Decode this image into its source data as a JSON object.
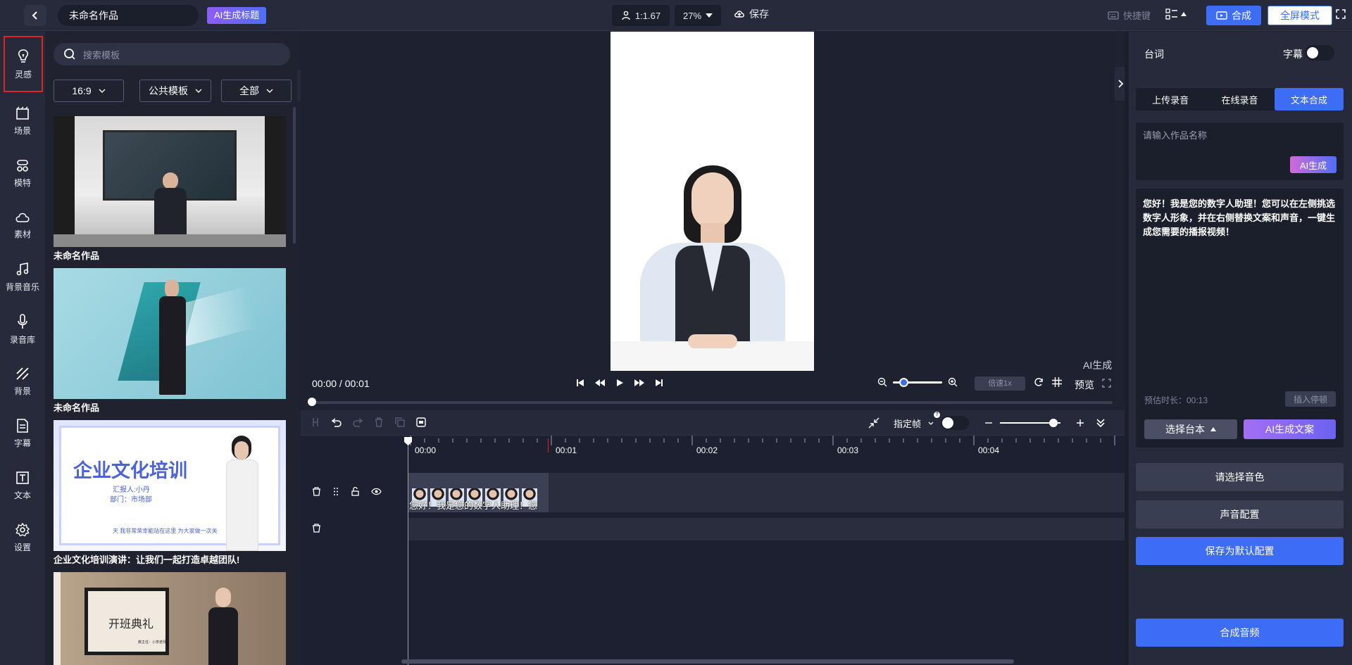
{
  "topbar": {
    "project_title": "未命名作品",
    "ai_title_label": "AI生成标题",
    "ratio": "1:1.67",
    "zoom": "27%",
    "save_label": "保存",
    "shortcut_label": "快捷键",
    "compose_label": "合成",
    "fullscreen_label": "全屏模式"
  },
  "nav": {
    "items": [
      {
        "label": "灵感",
        "icon": "lightbulb-icon",
        "active": true
      },
      {
        "label": "场景",
        "icon": "scene-icon"
      },
      {
        "label": "模特",
        "icon": "model-icon"
      },
      {
        "label": "素材",
        "icon": "cloud-icon"
      },
      {
        "label": "背景音乐",
        "icon": "music-icon"
      },
      {
        "label": "录音库",
        "icon": "microphone-icon"
      },
      {
        "label": "背景",
        "icon": "background-icon"
      },
      {
        "label": "字幕",
        "icon": "subtitle-icon"
      },
      {
        "label": "文本",
        "icon": "text-icon"
      },
      {
        "label": "设置",
        "icon": "gear-icon"
      }
    ]
  },
  "templates": {
    "search_placeholder": "搜索模板",
    "filters": [
      "16:9",
      "公共模板",
      "全部"
    ],
    "cards": [
      {
        "label": "未命名作品"
      },
      {
        "label": "未命名作品"
      },
      {
        "label": "企业文化培训演讲：让我们一起打造卓越团队!",
        "slide_title": "企业文化培训",
        "slide_sub1": "汇报人:小丹",
        "slide_sub2": "部门：市场部",
        "slide_footer": "天 我非常荣幸能站在这里 为大家做一次关"
      },
      {
        "label": "",
        "slide_title": "开班典礼",
        "slide_sub": "教主任：小李老师"
      }
    ]
  },
  "preview": {
    "watermark": "AI生成",
    "timecode": "00:00 / 00:01",
    "speed": "倍速1x",
    "preview_label": "预览",
    "zoom_level": 0.15,
    "progress": 0
  },
  "timeline": {
    "frame_label": "指定帧",
    "ticks": [
      "00:00",
      "00:01",
      "00:02",
      "00:03",
      "00:04"
    ],
    "clip_text": "您好！我是您的数字人助理！您",
    "scale_level": 0.95
  },
  "right": {
    "section_title": "台词",
    "subtitle_label": "字幕",
    "subtitle_on": false,
    "tabs": [
      "上传录音",
      "在线录音",
      "文本合成"
    ],
    "active_tab": 2,
    "name_placeholder": "请输入作品名称",
    "ai_generate": "AI生成",
    "script_text": "您好！我是您的数字人助理！您可以在左侧挑选数字人形象，并在右侧替换文案和声音，一键生成您需要的播报视频！",
    "duration": "预估时长：00:13",
    "insert_pause": "插入停顿",
    "choose_script": "选择台本",
    "ai_write": "AI生成文案",
    "choose_voice": "请选择音色",
    "voice_config": "声音配置",
    "save_default": "保存为默认配置",
    "compose_audio": "合成音频"
  },
  "colors": {
    "accent": "#3d6df5",
    "marker": "#e02424"
  }
}
